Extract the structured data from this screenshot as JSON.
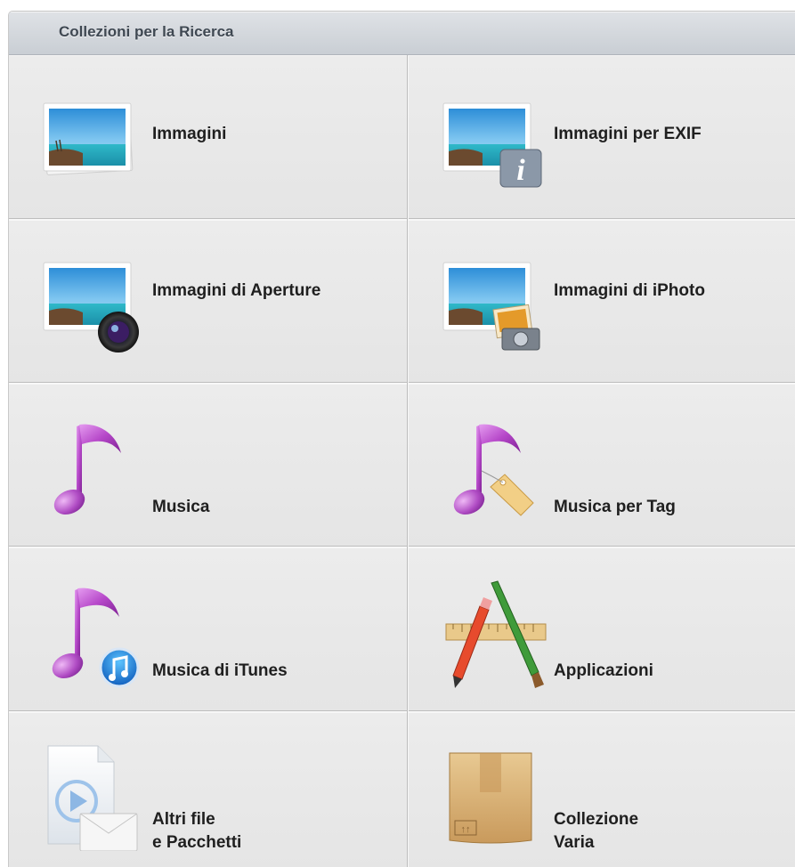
{
  "header": {
    "title": "Collezioni per la Ricerca"
  },
  "items": [
    {
      "label": "Immagini",
      "icon": "photo-icon"
    },
    {
      "label": "Immagini per EXIF",
      "icon": "photo-exif-icon"
    },
    {
      "label": "Immagini di Aperture",
      "icon": "photo-aperture-icon"
    },
    {
      "label": "Immagini di iPhoto",
      "icon": "photo-iphoto-icon"
    },
    {
      "label": "Musica",
      "icon": "music-note-icon"
    },
    {
      "label": "Musica per Tag",
      "icon": "music-tag-icon"
    },
    {
      "label": "Musica di iTunes",
      "icon": "music-itunes-icon"
    },
    {
      "label": "Applicazioni",
      "icon": "applications-icon"
    },
    {
      "label_line1": "Altri file",
      "label_line2": "e Pacchetti",
      "icon": "other-files-icon"
    },
    {
      "label_line1": "Collezione",
      "label_line2": "Varia",
      "icon": "box-icon"
    }
  ],
  "colors": {
    "note": "#b648c9",
    "header_text": "#3f4852",
    "box": "#d9b27a"
  }
}
